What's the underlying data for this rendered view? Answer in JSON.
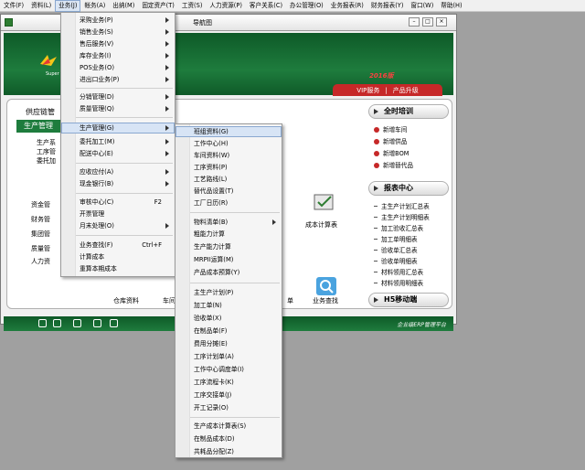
{
  "menubar": [
    {
      "label": "文件(F)"
    },
    {
      "label": "资料(L)"
    },
    {
      "label": "业务(J)"
    },
    {
      "label": "帐务(A)"
    },
    {
      "label": "出纳(M)"
    },
    {
      "label": "固定资产(T)"
    },
    {
      "label": "工资(S)"
    },
    {
      "label": "人力资源(P)"
    },
    {
      "label": "客户关系(C)"
    },
    {
      "label": "办公管理(O)"
    },
    {
      "label": "业务报表(R)"
    },
    {
      "label": "财务报表(Y)"
    },
    {
      "label": "窗口(W)"
    },
    {
      "label": "帮助(H)"
    }
  ],
  "nav_window": {
    "title": "导航图",
    "year_badge": "2016版",
    "upgrade": {
      "vip": "VIP服务",
      "sep": "|",
      "upgrade": "产品升级"
    },
    "left_title": "供应链管",
    "left_green": "生产管理",
    "left_subs": [
      "生产系",
      "工序管",
      "委托加"
    ],
    "left_groups": [
      "资金管",
      "财务管",
      "集团管",
      "质量管",
      "人力资"
    ],
    "bottom_labels": [
      "仓库资料",
      "车间",
      "成本计算表",
      "单",
      "业务查找"
    ],
    "right_panel": {
      "training_title": "全时培训",
      "training_items": [
        "新增车间",
        "新增供品",
        "新增BOM",
        "新增替代品"
      ],
      "report_title": "报表中心",
      "report_items": [
        "主生产计划汇总表",
        "主生产计划明细表",
        "加工验收汇总表",
        "加工单明细表",
        "验收单汇总表",
        "验收单明细表",
        "材料领用汇总表",
        "材料领用明细表"
      ],
      "h5_title": "H5移动端"
    },
    "footer_text": "企业级ERP管理平台"
  },
  "biz_menu": {
    "items": [
      {
        "label": "采购业务(P)",
        "sub": true
      },
      {
        "label": "销售业务(S)",
        "sub": true
      },
      {
        "label": "售后服务(V)",
        "sub": true
      },
      {
        "label": "库存业务(I)",
        "sub": true
      },
      {
        "label": "POS业务(O)",
        "sub": true
      },
      {
        "label": "进出口业务(P)",
        "sub": true
      },
      {
        "label": "分销管理(D)",
        "sub": true
      },
      {
        "label": "质量管理(Q)",
        "sub": true
      },
      {
        "label": "生产管理(G)",
        "sub": true
      },
      {
        "label": "委托加工(M)",
        "sub": true
      },
      {
        "label": "配送中心(E)",
        "sub": true
      },
      {
        "label": "应收应付(A)",
        "sub": true
      },
      {
        "label": "现金银行(B)",
        "sub": true
      },
      {
        "label": "审核中心(C)",
        "shortcut": "F2"
      },
      {
        "label": "开票管理"
      },
      {
        "label": "月末处理(O)",
        "sub": true
      },
      {
        "label": "业务查找(F)",
        "shortcut": "Ctrl+F"
      },
      {
        "label": "计算成本"
      },
      {
        "label": "重算本期成本"
      }
    ]
  },
  "production_menu": {
    "items": [
      "班组资料(G)",
      "工作中心(H)",
      "车间资料(W)",
      "工序资料(P)",
      "工艺路线(L)",
      "替代品设置(T)",
      "工厂日历(R)",
      "物料清单(B)",
      "粗能力计算",
      "生产能力计算",
      "MRPII运算(M)",
      "产品成本预算(Y)",
      "主生产计划(P)",
      "加工单(N)",
      "验收单(X)",
      "在制品单(F)",
      "费用分摊(E)",
      "工序计划单(A)",
      "工作中心调度单(I)",
      "工序流程卡(K)",
      "工序交接单(J)",
      "开工记录(O)",
      "生产成本计算表(S)",
      "在制品成本(D)",
      "共耗品分配(Z)"
    ]
  },
  "colors": {
    "nav_green": "#1e7c3d",
    "badge_red": "#c62828",
    "highlight": "#d7e4f5"
  }
}
